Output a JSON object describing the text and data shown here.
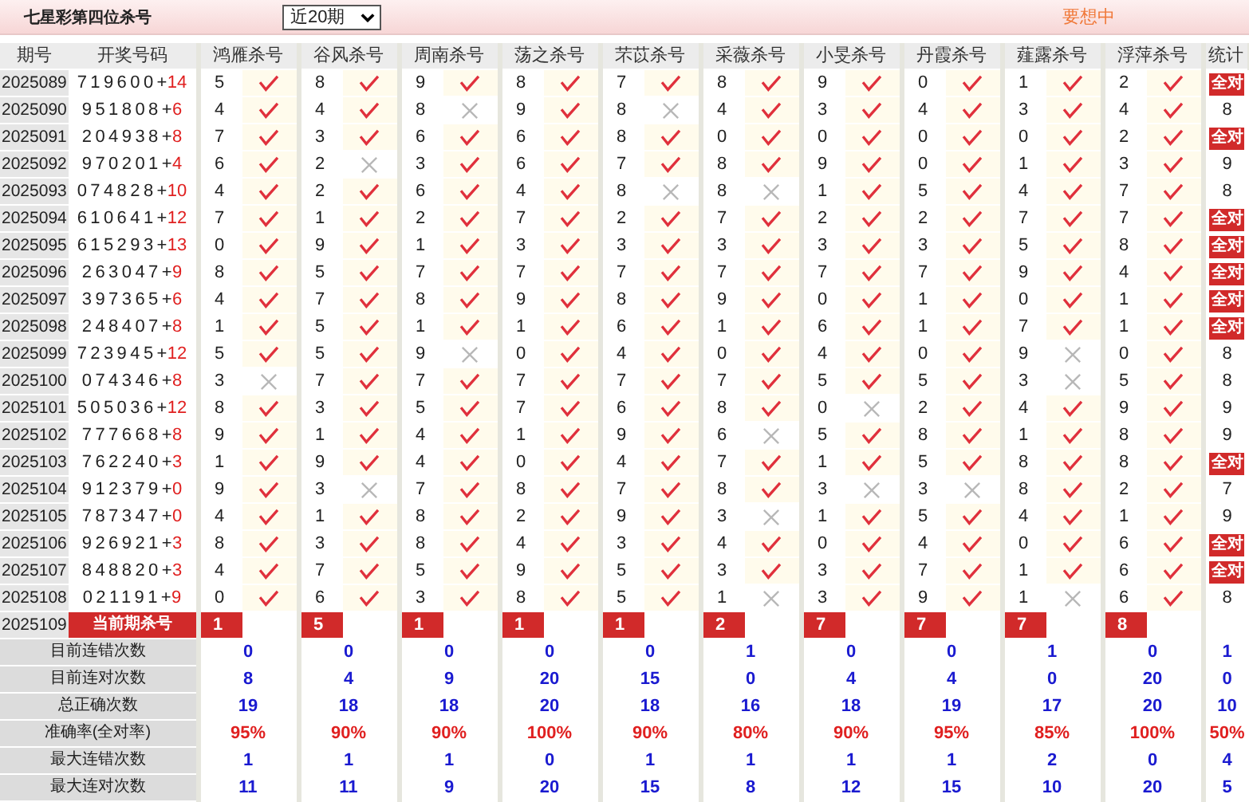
{
  "header": {
    "title": "七星彩第四位杀号",
    "period_select": "近20期",
    "promo_text": "要想中"
  },
  "table": {
    "columns": [
      "期号",
      "开奖号码",
      "鸿雁杀号",
      "谷风杀号",
      "周南杀号",
      "荡之杀号",
      "芣苡杀号",
      "采薇杀号",
      "小旻杀号",
      "丹霞杀号",
      "薤露杀号",
      "浮萍杀号",
      "统计"
    ],
    "rows": [
      {
        "issue": "2025089",
        "main": "719600+",
        "bonus": "14",
        "kills": [
          "5",
          "8",
          "9",
          "8",
          "7",
          "8",
          "9",
          "0",
          "1",
          "2"
        ],
        "hits": [
          true,
          true,
          true,
          true,
          true,
          true,
          true,
          true,
          true,
          true
        ],
        "stat": {
          "kind": "badge",
          "text": "全对"
        }
      },
      {
        "issue": "2025090",
        "main": "951808+",
        "bonus": "6",
        "kills": [
          "4",
          "4",
          "8",
          "9",
          "8",
          "4",
          "3",
          "4",
          "3",
          "4"
        ],
        "hits": [
          true,
          true,
          false,
          true,
          false,
          true,
          true,
          true,
          true,
          true
        ],
        "stat": {
          "kind": "count",
          "text": "8"
        }
      },
      {
        "issue": "2025091",
        "main": "204938+",
        "bonus": "8",
        "kills": [
          "7",
          "3",
          "6",
          "6",
          "8",
          "0",
          "0",
          "0",
          "0",
          "2"
        ],
        "hits": [
          true,
          true,
          true,
          true,
          true,
          true,
          true,
          true,
          true,
          true
        ],
        "stat": {
          "kind": "badge",
          "text": "全对"
        }
      },
      {
        "issue": "2025092",
        "main": "970201+",
        "bonus": "4",
        "kills": [
          "6",
          "2",
          "3",
          "6",
          "7",
          "8",
          "9",
          "0",
          "1",
          "3"
        ],
        "hits": [
          true,
          false,
          true,
          true,
          true,
          true,
          true,
          true,
          true,
          true
        ],
        "stat": {
          "kind": "count",
          "text": "9"
        }
      },
      {
        "issue": "2025093",
        "main": "074828+",
        "bonus": "10",
        "kills": [
          "4",
          "2",
          "6",
          "4",
          "8",
          "8",
          "1",
          "5",
          "4",
          "7"
        ],
        "hits": [
          true,
          true,
          true,
          true,
          false,
          false,
          true,
          true,
          true,
          true
        ],
        "stat": {
          "kind": "count",
          "text": "8"
        }
      },
      {
        "issue": "2025094",
        "main": "610641+",
        "bonus": "12",
        "kills": [
          "7",
          "1",
          "2",
          "7",
          "2",
          "7",
          "2",
          "2",
          "7",
          "7"
        ],
        "hits": [
          true,
          true,
          true,
          true,
          true,
          true,
          true,
          true,
          true,
          true
        ],
        "stat": {
          "kind": "badge",
          "text": "全对"
        }
      },
      {
        "issue": "2025095",
        "main": "615293+",
        "bonus": "13",
        "kills": [
          "0",
          "9",
          "1",
          "3",
          "3",
          "3",
          "3",
          "3",
          "5",
          "8"
        ],
        "hits": [
          true,
          true,
          true,
          true,
          true,
          true,
          true,
          true,
          true,
          true
        ],
        "stat": {
          "kind": "badge",
          "text": "全对"
        }
      },
      {
        "issue": "2025096",
        "main": "263047+",
        "bonus": "9",
        "kills": [
          "8",
          "5",
          "7",
          "7",
          "7",
          "7",
          "7",
          "7",
          "9",
          "4"
        ],
        "hits": [
          true,
          true,
          true,
          true,
          true,
          true,
          true,
          true,
          true,
          true
        ],
        "stat": {
          "kind": "badge",
          "text": "全对"
        }
      },
      {
        "issue": "2025097",
        "main": "397365+",
        "bonus": "6",
        "kills": [
          "4",
          "7",
          "8",
          "9",
          "8",
          "9",
          "0",
          "1",
          "0",
          "1"
        ],
        "hits": [
          true,
          true,
          true,
          true,
          true,
          true,
          true,
          true,
          true,
          true
        ],
        "stat": {
          "kind": "badge",
          "text": "全对"
        }
      },
      {
        "issue": "2025098",
        "main": "248407+",
        "bonus": "8",
        "kills": [
          "1",
          "5",
          "1",
          "1",
          "6",
          "1",
          "6",
          "1",
          "7",
          "1"
        ],
        "hits": [
          true,
          true,
          true,
          true,
          true,
          true,
          true,
          true,
          true,
          true
        ],
        "stat": {
          "kind": "badge",
          "text": "全对"
        }
      },
      {
        "issue": "2025099",
        "main": "723945+",
        "bonus": "12",
        "kills": [
          "5",
          "5",
          "9",
          "0",
          "4",
          "0",
          "4",
          "0",
          "9",
          "0"
        ],
        "hits": [
          true,
          true,
          false,
          true,
          true,
          true,
          true,
          true,
          false,
          true
        ],
        "stat": {
          "kind": "count",
          "text": "8"
        }
      },
      {
        "issue": "2025100",
        "main": "074346+",
        "bonus": "8",
        "kills": [
          "3",
          "7",
          "7",
          "7",
          "7",
          "7",
          "5",
          "5",
          "3",
          "5"
        ],
        "hits": [
          false,
          true,
          true,
          true,
          true,
          true,
          true,
          true,
          false,
          true
        ],
        "stat": {
          "kind": "count",
          "text": "8"
        }
      },
      {
        "issue": "2025101",
        "main": "505036+",
        "bonus": "12",
        "kills": [
          "8",
          "3",
          "5",
          "7",
          "6",
          "8",
          "0",
          "2",
          "4",
          "9"
        ],
        "hits": [
          true,
          true,
          true,
          true,
          true,
          true,
          false,
          true,
          true,
          true
        ],
        "stat": {
          "kind": "count",
          "text": "9"
        }
      },
      {
        "issue": "2025102",
        "main": "777668+",
        "bonus": "8",
        "kills": [
          "9",
          "1",
          "4",
          "1",
          "9",
          "6",
          "5",
          "8",
          "1",
          "8"
        ],
        "hits": [
          true,
          true,
          true,
          true,
          true,
          false,
          true,
          true,
          true,
          true
        ],
        "stat": {
          "kind": "count",
          "text": "9"
        }
      },
      {
        "issue": "2025103",
        "main": "762240+",
        "bonus": "3",
        "kills": [
          "1",
          "9",
          "4",
          "0",
          "4",
          "7",
          "1",
          "5",
          "8",
          "8"
        ],
        "hits": [
          true,
          true,
          true,
          true,
          true,
          true,
          true,
          true,
          true,
          true
        ],
        "stat": {
          "kind": "badge",
          "text": "全对"
        }
      },
      {
        "issue": "2025104",
        "main": "912379+",
        "bonus": "0",
        "kills": [
          "9",
          "3",
          "7",
          "8",
          "7",
          "8",
          "3",
          "3",
          "8",
          "2"
        ],
        "hits": [
          true,
          false,
          true,
          true,
          true,
          true,
          false,
          false,
          true,
          true
        ],
        "stat": {
          "kind": "count",
          "text": "7"
        }
      },
      {
        "issue": "2025105",
        "main": "787347+",
        "bonus": "0",
        "kills": [
          "4",
          "1",
          "8",
          "2",
          "9",
          "3",
          "1",
          "5",
          "4",
          "1"
        ],
        "hits": [
          true,
          true,
          true,
          true,
          true,
          false,
          true,
          true,
          true,
          true
        ],
        "stat": {
          "kind": "count",
          "text": "9"
        }
      },
      {
        "issue": "2025106",
        "main": "926921+",
        "bonus": "3",
        "kills": [
          "8",
          "3",
          "8",
          "4",
          "3",
          "4",
          "0",
          "4",
          "0",
          "6"
        ],
        "hits": [
          true,
          true,
          true,
          true,
          true,
          true,
          true,
          true,
          true,
          true
        ],
        "stat": {
          "kind": "badge",
          "text": "全对"
        }
      },
      {
        "issue": "2025107",
        "main": "848820+",
        "bonus": "3",
        "kills": [
          "4",
          "7",
          "5",
          "9",
          "5",
          "3",
          "3",
          "7",
          "1",
          "6"
        ],
        "hits": [
          true,
          true,
          true,
          true,
          true,
          true,
          true,
          true,
          true,
          true
        ],
        "stat": {
          "kind": "badge",
          "text": "全对"
        }
      },
      {
        "issue": "2025108",
        "main": "021191+",
        "bonus": "9",
        "kills": [
          "0",
          "6",
          "3",
          "8",
          "5",
          "1",
          "3",
          "9",
          "1",
          "6"
        ],
        "hits": [
          true,
          true,
          true,
          true,
          true,
          false,
          true,
          true,
          false,
          true
        ],
        "stat": {
          "kind": "count",
          "text": "8"
        }
      }
    ],
    "current": {
      "issue": "2025109",
      "label": "当前期杀号",
      "kills": [
        "1",
        "5",
        "1",
        "1",
        "1",
        "2",
        "7",
        "7",
        "7",
        "8"
      ]
    },
    "summary": [
      {
        "label": "目前连错次数",
        "kind": "count",
        "values": [
          "0",
          "0",
          "0",
          "0",
          "0",
          "1",
          "0",
          "0",
          "1",
          "0",
          "1"
        ]
      },
      {
        "label": "目前连对次数",
        "kind": "count",
        "values": [
          "8",
          "4",
          "9",
          "20",
          "15",
          "0",
          "4",
          "4",
          "0",
          "20",
          "0"
        ]
      },
      {
        "label": "总正确次数",
        "kind": "count",
        "values": [
          "19",
          "18",
          "18",
          "20",
          "18",
          "16",
          "18",
          "19",
          "17",
          "20",
          "10"
        ]
      },
      {
        "label": "准确率(全对率)",
        "kind": "rate",
        "values": [
          "95%",
          "90%",
          "90%",
          "100%",
          "90%",
          "80%",
          "90%",
          "95%",
          "85%",
          "100%",
          "50%"
        ]
      },
      {
        "label": "最大连错次数",
        "kind": "count",
        "values": [
          "1",
          "1",
          "1",
          "0",
          "1",
          "1",
          "1",
          "1",
          "2",
          "0",
          "4"
        ]
      },
      {
        "label": "最大连对次数",
        "kind": "count",
        "values": [
          "11",
          "11",
          "9",
          "20",
          "15",
          "8",
          "12",
          "15",
          "10",
          "20",
          "5"
        ]
      }
    ]
  }
}
